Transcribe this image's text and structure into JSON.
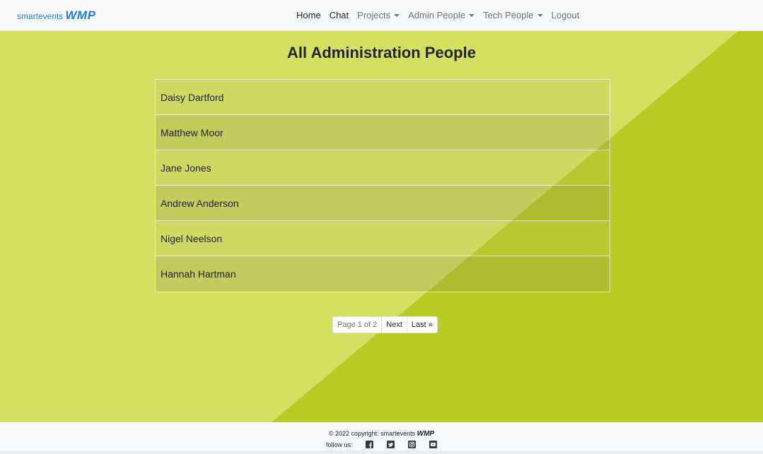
{
  "brand": {
    "small": "smartevents",
    "big": "WMP"
  },
  "nav": {
    "items": [
      {
        "label": "Home"
      },
      {
        "label": "Chat"
      },
      {
        "label": "Projects"
      },
      {
        "label": "Admin People"
      },
      {
        "label": "Tech People"
      },
      {
        "label": "Logout"
      }
    ]
  },
  "main": {
    "title": "All Administration People",
    "people": [
      "Daisy Dartford",
      "Matthew Moor",
      "Jane Jones",
      "Andrew Anderson",
      "Nigel Neelson",
      "Hannah Hartman"
    ],
    "pagination": {
      "info": "Page 1 of 2",
      "next": "Next",
      "last": "Last »"
    }
  },
  "footer": {
    "copyright_prefix": "© 2022 copyright: smartevents",
    "copyright_brand": "WMP",
    "follow_label": "follow us:",
    "social_icons": [
      "facebook-icon",
      "twitter-icon",
      "instagram-icon",
      "youtube-icon"
    ]
  },
  "colors": {
    "background_light": "#d4e062",
    "background_dark": "#b9cb22",
    "brand": "#1f7ee0"
  }
}
